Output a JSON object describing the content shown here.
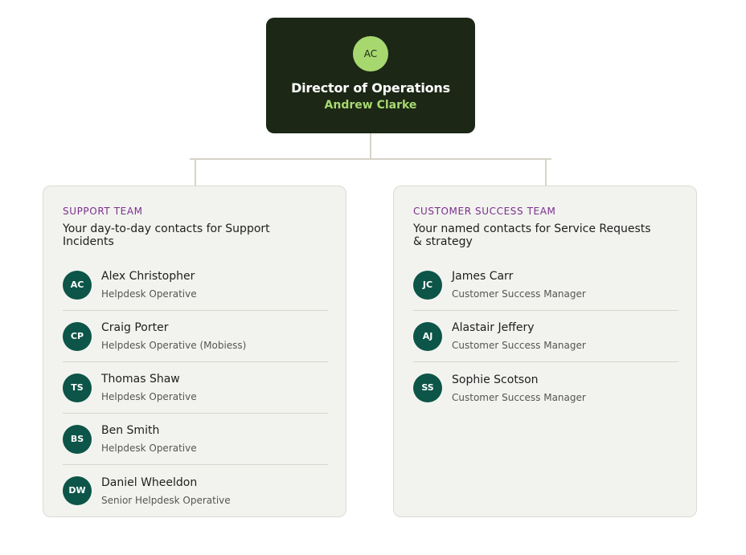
{
  "director": {
    "initials": "AC",
    "role": "Director of Operations",
    "name": "Andrew Clarke"
  },
  "teams": [
    {
      "label": "SUPPORT TEAM",
      "description": "Your day-to-day contacts for Support Incidents",
      "members": [
        {
          "initials": "AC",
          "name": "Alex Christopher",
          "role": "Helpdesk Operative"
        },
        {
          "initials": "CP",
          "name": "Craig Porter",
          "role": "Helpdesk Operative (Mobiess)"
        },
        {
          "initials": "TS",
          "name": "Thomas Shaw",
          "role": "Helpdesk Operative"
        },
        {
          "initials": "BS",
          "name": "Ben Smith",
          "role": "Helpdesk Operative"
        },
        {
          "initials": "DW",
          "name": "Daniel Wheeldon",
          "role": "Senior Helpdesk Operative"
        }
      ]
    },
    {
      "label": "CUSTOMER SUCCESS TEAM",
      "description": "Your named contacts for Service Requests & strategy",
      "members": [
        {
          "initials": "JC",
          "name": "James Carr",
          "role": "Customer Success Manager"
        },
        {
          "initials": "AJ",
          "name": "Alastair Jeffery",
          "role": "Customer Success Manager"
        },
        {
          "initials": "SS",
          "name": "Sophie Scotson",
          "role": "Customer Success Manager"
        }
      ]
    }
  ],
  "colors": {
    "director_bg": "#1c2716",
    "accent_green": "#a7d86f",
    "avatar_teal": "#0c5548",
    "team_label_purple": "#7a2e8c",
    "card_bg": "#f2f3ef"
  }
}
